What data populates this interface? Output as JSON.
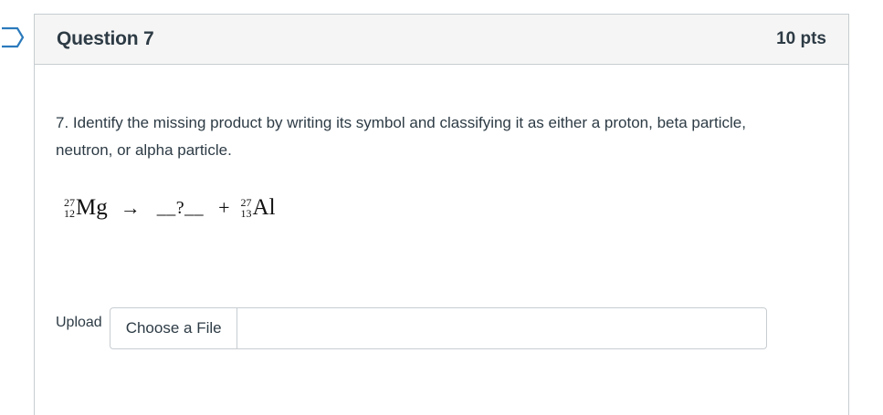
{
  "question": {
    "title": "Question 7",
    "points": "10 pts",
    "text": "7. Identify the missing product by writing its symbol and classifying it as either a proton, beta particle, neutron, or alpha particle."
  },
  "equation": {
    "reactant": {
      "mass": "27",
      "atomic": "12",
      "symbol": "Mg"
    },
    "arrow": "→",
    "blank": "__?__",
    "plus": "+",
    "product": {
      "mass": "27",
      "atomic": "13",
      "symbol": "Al"
    }
  },
  "upload": {
    "label": "Upload",
    "button_label": "Choose a File",
    "file_name": ""
  }
}
